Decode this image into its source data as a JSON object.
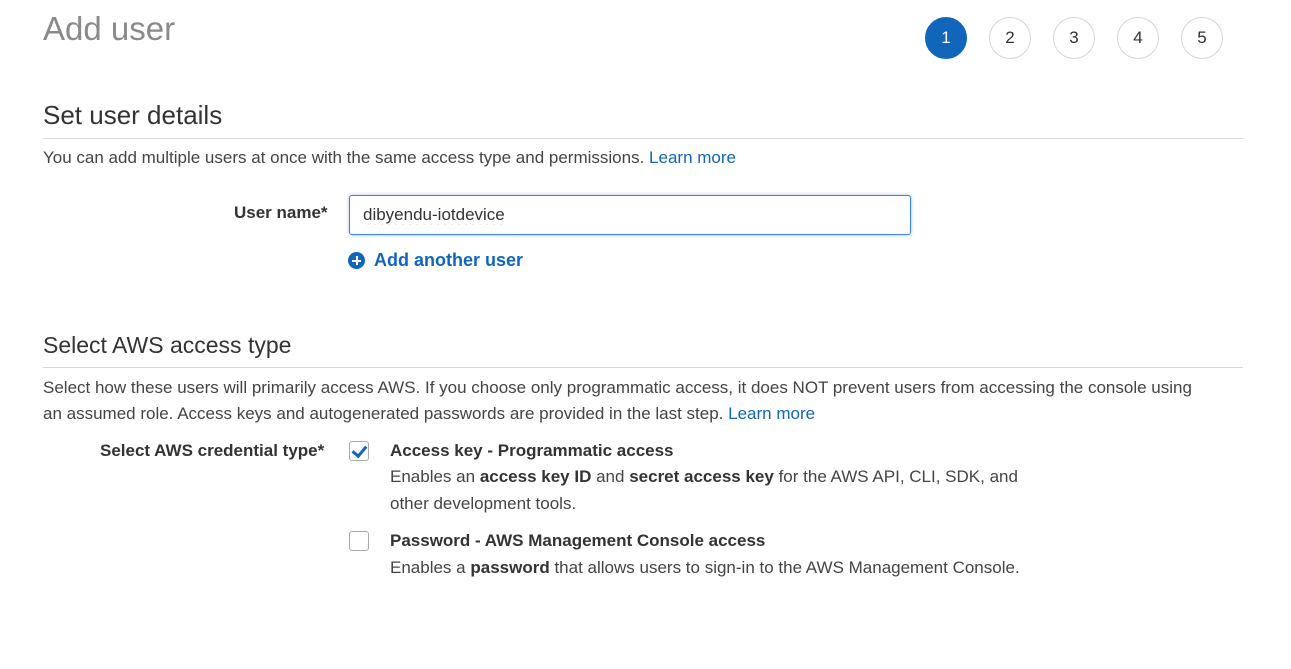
{
  "page": {
    "title": "Add user"
  },
  "steps": [
    "1",
    "2",
    "3",
    "4",
    "5"
  ],
  "active_step": "1",
  "user_details": {
    "section_title": "Set user details",
    "description": "You can add multiple users at once with the same access type and permissions.",
    "learn_more": "Learn more",
    "user_name_label": "User name*",
    "user_name_value": "dibyendu-iotdevice",
    "add_another_user": "Add another user"
  },
  "access_type": {
    "section_title": "Select AWS access type",
    "description_line1": "Select how these users will primarily access AWS. If you choose only programmatic access, it does NOT prevent users from accessing the console using",
    "description_line2": "an assumed role. Access keys and autogenerated passwords are provided in the last step.",
    "learn_more": "Learn more",
    "credential_label": "Select AWS credential type*",
    "options": [
      {
        "title": "Access key - Programmatic access",
        "checked": true,
        "desc_1": "Enables an",
        "desc_b1": "access key ID",
        "desc_2": "and",
        "desc_b2": "secret access key",
        "desc_3": "for the AWS API, CLI, SDK, and",
        "desc_line2": "other development tools."
      },
      {
        "title": "Password - AWS Management Console access",
        "checked": false,
        "desc_1": "Enables a",
        "desc_b1": "password",
        "desc_2": "that allows users to sign-in to the AWS Management Console."
      }
    ]
  },
  "colors": {
    "accent": "#1166bb",
    "title_grey": "#8a8a8a"
  }
}
